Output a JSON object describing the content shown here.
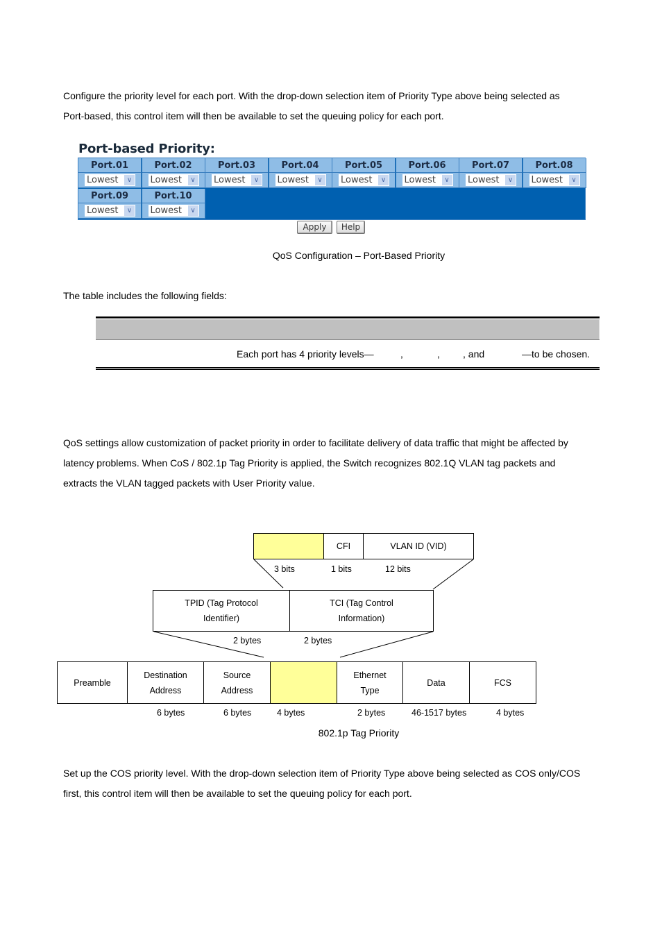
{
  "intro_paragraph": {
    "line1": "Configure the priority level for each port. With the drop-down selection item of Priority Type above being selected as",
    "line2": "Port-based, this control item will then be available to set the queuing policy for each port."
  },
  "port_based_priority": {
    "title": "Port-based Priority:",
    "ports": [
      {
        "label": "Port.01",
        "value": "Lowest"
      },
      {
        "label": "Port.02",
        "value": "Lowest"
      },
      {
        "label": "Port.03",
        "value": "Lowest"
      },
      {
        "label": "Port.04",
        "value": "Lowest"
      },
      {
        "label": "Port.05",
        "value": "Lowest"
      },
      {
        "label": "Port.06",
        "value": "Lowest"
      },
      {
        "label": "Port.07",
        "value": "Lowest"
      },
      {
        "label": "Port.08",
        "value": "Lowest"
      },
      {
        "label": "Port.09",
        "value": "Lowest"
      },
      {
        "label": "Port.10",
        "value": "Lowest"
      }
    ],
    "dropdown_icon": "chevron-down-icon",
    "apply_label": "Apply",
    "help_label": "Help",
    "colors": {
      "header_bg": "#8fbde6",
      "table_bg": "#0060b0"
    }
  },
  "caption_1": "QoS Configuration – Port-Based Priority",
  "fields_intro": "The table includes the following fields:",
  "fields_table": {
    "row_text_a": "Each port has 4 priority levels—",
    "sep1": ",",
    "sep2": ",",
    "sep3": ", and",
    "row_text_b": "—to be chosen."
  },
  "cos_paragraph": {
    "line1": "QoS settings allow customization of packet priority in order to facilitate delivery of data traffic that might be affected by",
    "line2": "latency problems. When CoS / 802.1p Tag Priority is applied, the Switch recognizes 802.1Q VLAN tag packets and",
    "line3": "extracts the VLAN tagged packets with User Priority value."
  },
  "diagram": {
    "tci_fields": [
      {
        "label": "",
        "size": "3 bits",
        "highlight": true
      },
      {
        "label": "CFI",
        "size": "1 bits"
      },
      {
        "label": "VLAN ID (VID)",
        "size": "12 bits"
      }
    ],
    "tag_fields": [
      {
        "line1": "TPID (Tag Protocol",
        "line2": "Identifier)",
        "size": "2 bytes"
      },
      {
        "line1": "TCI (Tag Control",
        "line2": "Information)",
        "size": "2 bytes"
      }
    ],
    "frame_fields": [
      {
        "line1": "Preamble",
        "line2": "",
        "size": ""
      },
      {
        "line1": "Destination",
        "line2": "Address",
        "size": "6 bytes"
      },
      {
        "line1": "Source",
        "line2": "Address",
        "size": "6 bytes"
      },
      {
        "line1": "",
        "line2": "",
        "size": "4 bytes",
        "highlight": true
      },
      {
        "line1": "Ethernet",
        "line2": "Type",
        "size": "2 bytes"
      },
      {
        "line1": "Data",
        "line2": "",
        "size": "46-1517 bytes"
      },
      {
        "line1": "FCS",
        "line2": "",
        "size": "4 bytes"
      }
    ],
    "highlight_color": "#ffff99"
  },
  "caption_2": "802.1p Tag Priority",
  "cos_setup_paragraph": {
    "line1": "Set up the COS priority level. With the drop-down selection item of Priority Type above being selected as COS only/COS",
    "line2": "first, this control item will then be available to set the queuing policy for each port."
  }
}
